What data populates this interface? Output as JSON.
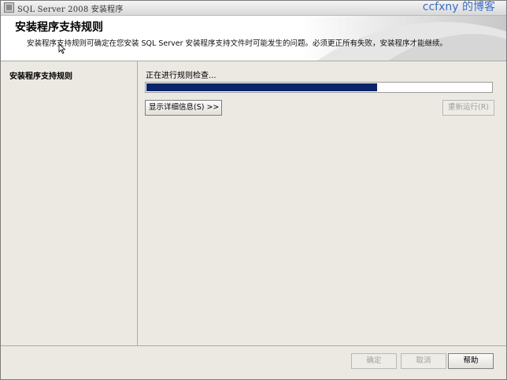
{
  "window": {
    "title": "SQL Server 2008 安装程序",
    "watermark": "ccfxny 的博客"
  },
  "header": {
    "title": "安装程序支持规则",
    "description": "安装程序支持规则可确定在您安装 SQL Server 安装程序支持文件时可能发生的问题。必须更正所有失败，安装程序才能继续。"
  },
  "nav": {
    "items": [
      {
        "label": "安装程序支持规则"
      }
    ]
  },
  "content": {
    "status": "正在进行规则检查...",
    "progress": 0.67,
    "show_details_button": "显示详细信息(S) >>",
    "rerun_button": "重新运行(R)"
  },
  "footer": {
    "ok_button": "确定",
    "cancel_button": "取消",
    "help_button": "帮助"
  },
  "colors": {
    "progress_fill": "#0a246a",
    "header_bg": "#ffffff",
    "panel_bg": "#ece9e3"
  }
}
